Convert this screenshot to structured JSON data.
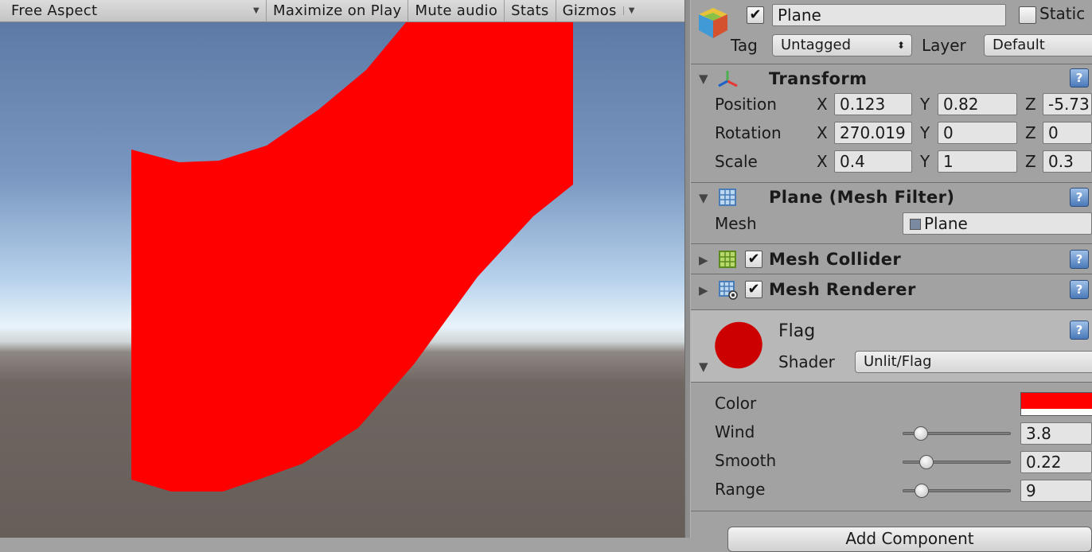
{
  "game_toolbar": {
    "aspect": "Free Aspect",
    "maximize_on_play": "Maximize on Play",
    "mute_audio": "Mute audio",
    "stats": "Stats",
    "gizmos": "Gizmos"
  },
  "object": {
    "active": true,
    "name": "Plane",
    "static_label": "Static",
    "static": false,
    "tag_label": "Tag",
    "tag_value": "Untagged",
    "layer_label": "Layer",
    "layer_value": "Default"
  },
  "transform": {
    "title": "Transform",
    "position": {
      "label": "Position",
      "x": "0.123",
      "y": "0.82",
      "z": "-5.73"
    },
    "rotation": {
      "label": "Rotation",
      "x": "270.019",
      "y": "0",
      "z": "0"
    },
    "scale": {
      "label": "Scale",
      "x": "0.4",
      "y": "1",
      "z": "0.3"
    },
    "axis_x": "X",
    "axis_y": "Y",
    "axis_z": "Z"
  },
  "mesh_filter": {
    "title": "Plane (Mesh Filter)",
    "mesh_label": "Mesh",
    "mesh_value": "Plane"
  },
  "mesh_collider": {
    "title": "Mesh Collider",
    "enabled": true
  },
  "mesh_renderer": {
    "title": "Mesh Renderer",
    "enabled": true
  },
  "material": {
    "name": "Flag",
    "shader_label": "Shader",
    "shader_value": "Unlit/Flag",
    "color_label": "Color",
    "color_value": "#ff0000",
    "properties": [
      {
        "label": "Wind",
        "value": "3.8",
        "slider_fraction": 0.17
      },
      {
        "label": "Smooth",
        "value": "0.22",
        "slider_fraction": 0.22
      },
      {
        "label": "Range",
        "value": "9",
        "slider_fraction": 0.18
      }
    ]
  },
  "add_component": "Add Component",
  "colors": {
    "flag": "#ff0000",
    "material_preview": "#cc0000",
    "inspector_bg": "#a2a2a2"
  }
}
